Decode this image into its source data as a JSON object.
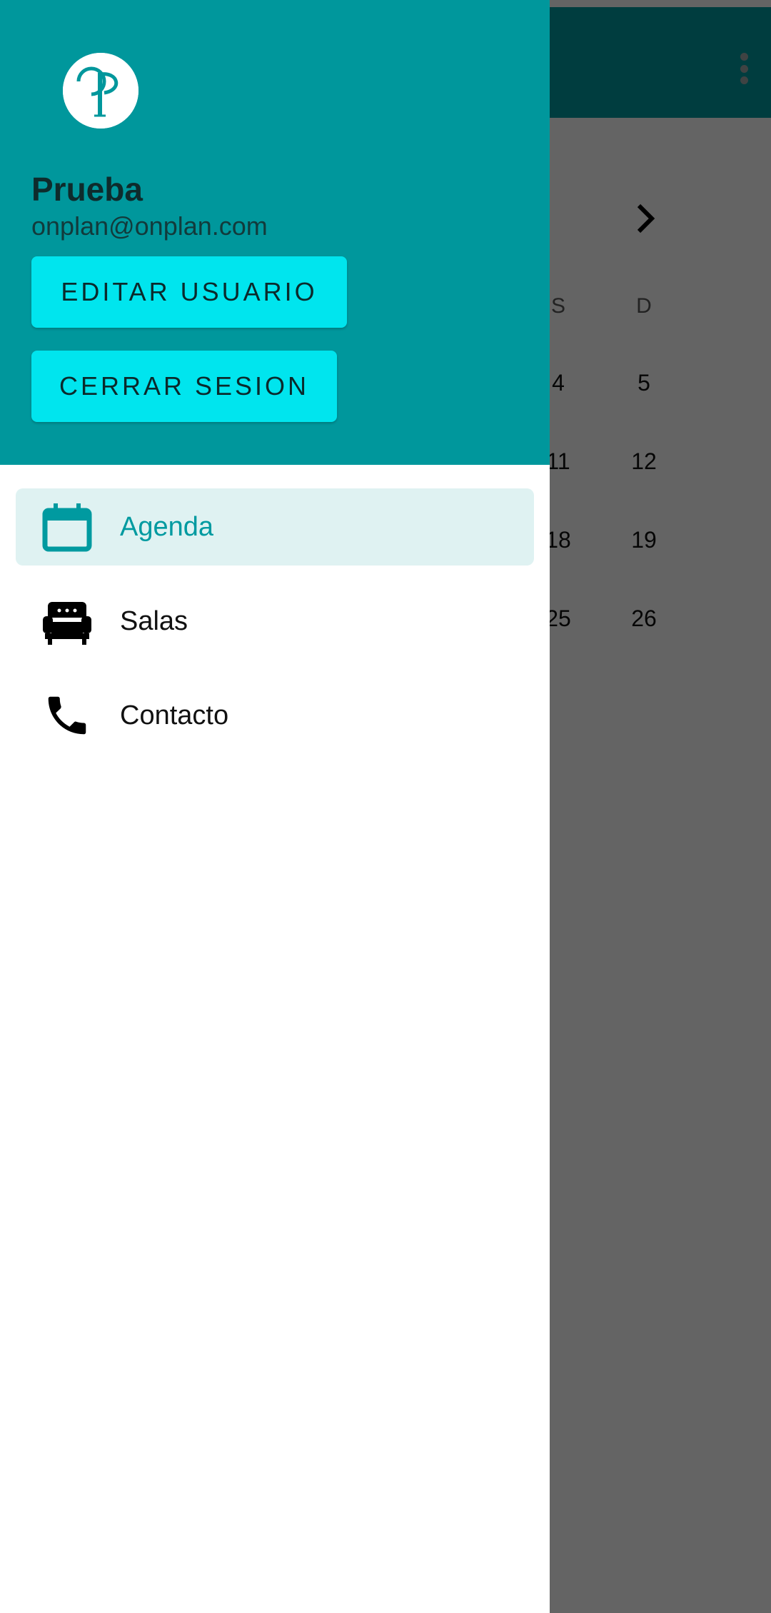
{
  "background": {
    "weekdays": [
      "S",
      "D"
    ],
    "calendar_rows": [
      [
        "4",
        "5"
      ],
      [
        "11",
        "12"
      ],
      [
        "18",
        "19"
      ],
      [
        "25",
        "26"
      ]
    ],
    "colors": {
      "appbar": "#009a9f",
      "scrim": "rgba(0,0,0,0.6)"
    }
  },
  "drawer": {
    "header": {
      "logo_text": "OP",
      "user_name": "Prueba",
      "user_email": "onplan@onplan.com",
      "edit_button": "EDITAR USUARIO",
      "logout_button": "CERRAR SESION",
      "background_color": "#00979c",
      "button_color": "#00e5ee"
    },
    "items": [
      {
        "label": "Agenda",
        "icon": "calendar-icon",
        "active": true
      },
      {
        "label": "Salas",
        "icon": "armchair-icon",
        "active": false
      },
      {
        "label": "Contacto",
        "icon": "phone-icon",
        "active": false
      }
    ],
    "accent_color": "#009aa0"
  }
}
